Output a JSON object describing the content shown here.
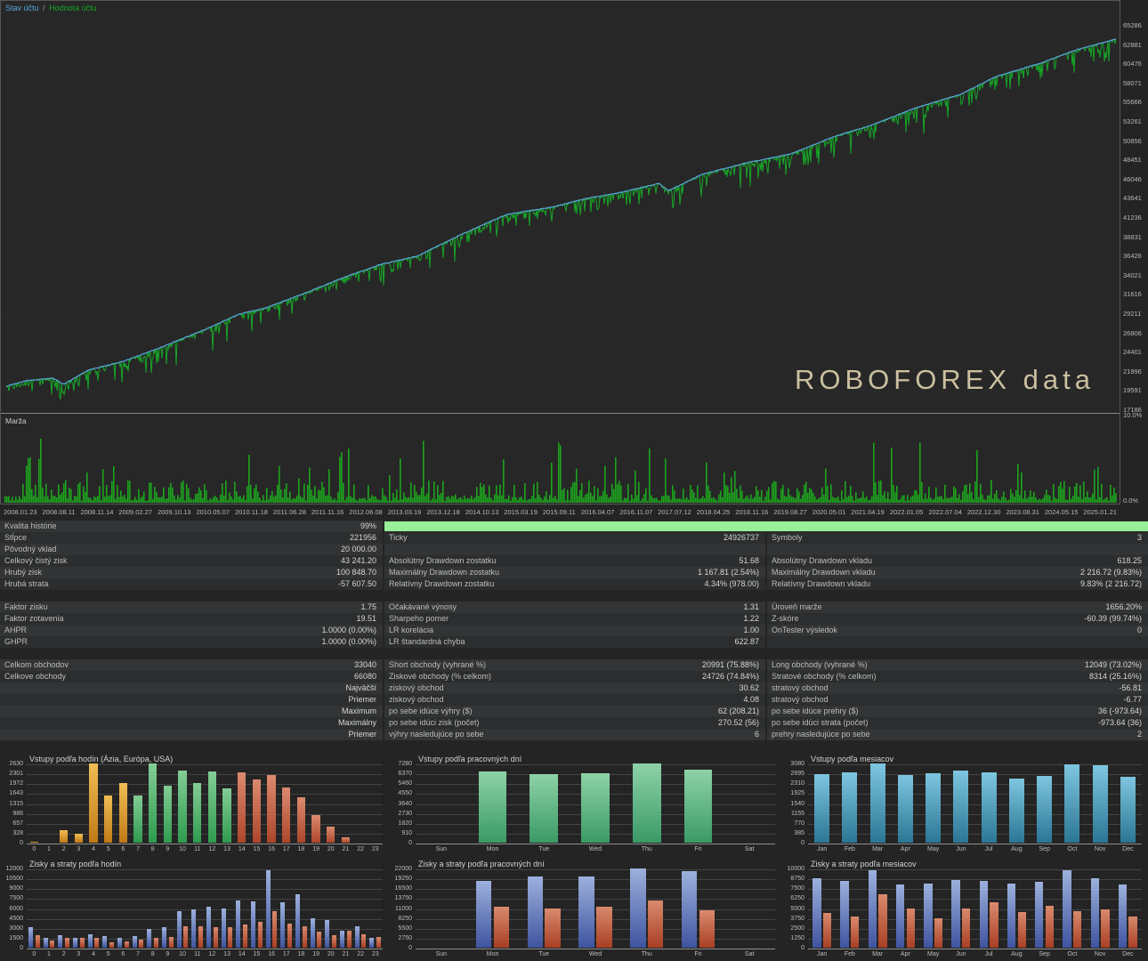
{
  "stats": {
    "rows": [
      {
        "cells": [
          "Kvalita histórie",
          "99%",
          "",
          "",
          "",
          ""
        ],
        "progress": true
      },
      {
        "cells": [
          "Stĺpce",
          "221956",
          "Ticky",
          "24926737",
          "Symboly",
          "3"
        ]
      },
      {
        "cells": [
          "Pôvodný vklad",
          "20 000.00",
          "",
          "",
          "",
          ""
        ]
      },
      {
        "cells": [
          "Celkový čistý zisk",
          "43 241.20",
          "Absolútny Drawdown zostatku",
          "51.68",
          "Absolútny Drawdown vkladu",
          "618.25"
        ]
      },
      {
        "cells": [
          "Hrubý zisk",
          "100 848.70",
          "Maximálny Drawdown zostatku",
          "1 167.81 (2.54%)",
          "Maximálny Drawdown vkladu",
          "2 216.72 (9.83%)"
        ]
      },
      {
        "cells": [
          "Hrubá strata",
          "-57 607.50",
          "Relatívny Drawdown zostatku",
          "4.34% (978.00)",
          "Relatívny Drawdown vkladu",
          "9.83% (2 216.72)"
        ]
      },
      {
        "spacer": true
      },
      {
        "cells": [
          "Faktor zisku",
          "1.75",
          "Očakávané výnosy",
          "1.31",
          "Úroveň marže",
          "1656.20%"
        ]
      },
      {
        "cells": [
          "Faktor zotavenia",
          "19.51",
          "Sharpeho pomer",
          "1.22",
          "Z-skóre",
          "-60.39 (99.74%)"
        ]
      },
      {
        "cells": [
          "AHPR",
          "1.0000 (0.00%)",
          "LR korelácia",
          "1.00",
          "OnTester výsledok",
          "0"
        ]
      },
      {
        "cells": [
          "GHPR",
          "1.0000 (0.00%)",
          "LR štandardná chyba",
          "622.87",
          "",
          ""
        ]
      },
      {
        "spacer": true
      },
      {
        "cells": [
          "Celkom obchodov",
          "33040",
          "Short obchody (vyhrané %)",
          "20991 (75.88%)",
          "Long obchody (vyhrané %)",
          "12049 (73.02%)"
        ]
      },
      {
        "cells": [
          "Celkove obchody",
          "66080",
          "Ziskové obchody (% celkom)",
          "24726 (74.84%)",
          "Stratové obchody (% celkom)",
          "8314 (25.16%)"
        ]
      },
      {
        "cells": [
          "",
          "Najväčší",
          "ziskový obchod",
          "30.62",
          "stratový obchod",
          "-56.81"
        ]
      },
      {
        "cells": [
          "",
          "Priemer",
          "ziskový obchod",
          "4.08",
          "stratový obchod",
          "-6.77"
        ]
      },
      {
        "cells": [
          "",
          "Maximum",
          "po sebe idúce výhry ($)",
          "62 (208.21)",
          "po sebe idúce prehry ($)",
          "36 (-973.64)"
        ]
      },
      {
        "cells": [
          "",
          "Maximálny",
          "po sebe idúci zisk (počet)",
          "270.52 (56)",
          "po sebe idúci strata (počet)",
          "-973.64 (36)"
        ]
      },
      {
        "cells": [
          "",
          "Priemer",
          "výhry nasledujúce po sebe",
          "6",
          "prehry nasledujúce po sebe",
          "2"
        ]
      },
      {
        "spacer": true
      }
    ],
    "progress_color": "#98ef98"
  },
  "chart_data": [
    {
      "type": "line",
      "name": "equity-curve",
      "legend": [
        "Stav účtu",
        "Hodnota účtu"
      ],
      "legend_sep": "/",
      "series": [
        {
          "name": "Stav účtu",
          "color": "#58a6dc"
        },
        {
          "name": "Hodnota účtu",
          "color": "#17a626"
        }
      ],
      "watermark": "ROBOFOREX data",
      "y_ticks": [
        65286,
        62881,
        60476,
        58071,
        55666,
        53261,
        50856,
        48451,
        46046,
        43641,
        41236,
        38831,
        36426,
        34021,
        31616,
        29211,
        26806,
        24401,
        21996,
        19591,
        17186
      ],
      "x_ticks": [
        "2008.01.23",
        "2008.08.11",
        "2008.11.14",
        "2009.02.27",
        "2009.10.13",
        "2010.05.07",
        "2010.11.18",
        "2011.06.28",
        "2011.11.16",
        "2012.06.08",
        "2013.03.19",
        "2013.12.18",
        "2014.10.13",
        "2015.03.19",
        "2015.09.11",
        "2016.04.07",
        "2016.11.07",
        "2017.07.12",
        "2018.04.25",
        "2018.11.16",
        "2019.08.27",
        "2020.05.01",
        "2021.04.19",
        "2022.01.05",
        "2022.07.04",
        "2022.12.30",
        "2023.08.31",
        "2024.05.15",
        "2025.01.21"
      ],
      "anchors": [
        [
          0,
          20190
        ],
        [
          0.018,
          20860
        ],
        [
          0.042,
          21190
        ],
        [
          0.052,
          20450
        ],
        [
          0.074,
          22200
        ],
        [
          0.106,
          23310
        ],
        [
          0.142,
          25200
        ],
        [
          0.178,
          27210
        ],
        [
          0.21,
          29215
        ],
        [
          0.234,
          29990
        ],
        [
          0.266,
          31660
        ],
        [
          0.306,
          33890
        ],
        [
          0.338,
          35450
        ],
        [
          0.37,
          36450
        ],
        [
          0.411,
          39235
        ],
        [
          0.451,
          41684
        ],
        [
          0.491,
          42575
        ],
        [
          0.523,
          43688
        ],
        [
          0.555,
          44468
        ],
        [
          0.588,
          45580
        ],
        [
          0.597,
          44650
        ],
        [
          0.627,
          46693
        ],
        [
          0.667,
          48140
        ],
        [
          0.707,
          49253
        ],
        [
          0.747,
          51480
        ],
        [
          0.779,
          52816
        ],
        [
          0.82,
          55043
        ],
        [
          0.86,
          56713
        ],
        [
          0.892,
          58940
        ],
        [
          0.932,
          60610
        ],
        [
          0.964,
          62280
        ],
        [
          1,
          63616
        ]
      ]
    },
    {
      "type": "bar",
      "name": "margin",
      "title": "Marža",
      "y_ticks": [
        "10.0%",
        "0.0%"
      ],
      "bar_color": "#1da31d"
    },
    {
      "type": "bar",
      "title": "Vstupy podľa hodín (Ázia, Európa, USA)",
      "categories": [
        "0",
        "1",
        "2",
        "3",
        "4",
        "5",
        "6",
        "7",
        "8",
        "9",
        "10",
        "11",
        "12",
        "13",
        "14",
        "15",
        "16",
        "17",
        "18",
        "19",
        "20",
        "21",
        "22",
        "23"
      ],
      "values": [
        30,
        0,
        420,
        310,
        2630,
        1560,
        1980,
        1570,
        2630,
        1900,
        2390,
        1970,
        2360,
        1790,
        2330,
        2100,
        2240,
        1830,
        1500,
        930,
        520,
        190,
        0,
        0
      ],
      "groups": [
        0,
        0,
        0,
        0,
        0,
        0,
        0,
        1,
        1,
        1,
        1,
        1,
        1,
        1,
        2,
        2,
        2,
        2,
        2,
        2,
        2,
        2,
        2,
        2
      ],
      "group_colors": [
        [
          "#f0bd55",
          "#c07a16"
        ],
        [
          "#84cd96",
          "#2e9b4e"
        ],
        [
          "#db8a70",
          "#ad462a"
        ]
      ],
      "ticks": [
        0,
        328,
        657,
        986,
        1315,
        1643,
        1972,
        2301,
        2630
      ]
    },
    {
      "type": "bar",
      "title": "Vstupy podľa pracovných dní",
      "categories": [
        "Sun",
        "Mon",
        "Tue",
        "Wed",
        "Thu",
        "Fri",
        "Sat"
      ],
      "values": [
        0,
        6550,
        6300,
        6350,
        7280,
        6750,
        0
      ],
      "color": [
        "#8ed2a8",
        "#3a9a66"
      ],
      "ticks": [
        0,
        910,
        1820,
        2730,
        3640,
        4550,
        5460,
        6370,
        7280
      ]
    },
    {
      "type": "bar",
      "title": "Vstupy podľa mesiacov",
      "categories": [
        "Jan",
        "Feb",
        "Mar",
        "Apr",
        "May",
        "Jun",
        "Jul",
        "Aug",
        "Sep",
        "Oct",
        "Nov",
        "Dec"
      ],
      "values": [
        2670,
        2750,
        3080,
        2640,
        2700,
        2790,
        2720,
        2510,
        2610,
        3060,
        3020,
        2570
      ],
      "color": [
        "#7ec6e0",
        "#2b7694"
      ],
      "ticks": [
        0,
        385,
        770,
        1155,
        1540,
        1925,
        2310,
        2695,
        3080
      ]
    },
    {
      "type": "bar",
      "title": "Zisky a straty podľa hodín",
      "categories": [
        "0",
        "1",
        "2",
        "3",
        "4",
        "5",
        "6",
        "7",
        "8",
        "9",
        "10",
        "11",
        "12",
        "13",
        "14",
        "15",
        "16",
        "17",
        "18",
        "19",
        "20",
        "21",
        "22",
        "23"
      ],
      "series": [
        {
          "name": "zisky",
          "color": [
            "#9db1dd",
            "#3f54a0"
          ],
          "values": [
            3050,
            1450,
            1900,
            1500,
            2000,
            1750,
            1500,
            1700,
            2850,
            3100,
            5600,
            5800,
            6200,
            6000,
            7100,
            7050,
            11800,
            6900,
            8100,
            4400,
            4200,
            2600,
            3200,
            1550
          ]
        },
        {
          "name": "straty",
          "color": [
            "#d98a6e",
            "#a93f24"
          ],
          "values": [
            1900,
            1150,
            1500,
            1500,
            1550,
            850,
            900,
            1200,
            1500,
            1650,
            3300,
            3250,
            3050,
            3100,
            3500,
            3950,
            5600,
            3700,
            3300,
            2500,
            1900,
            2550,
            2050,
            1600
          ]
        }
      ],
      "ticks": [
        0,
        1500,
        3000,
        4500,
        6000,
        7500,
        9000,
        10500,
        12000
      ]
    },
    {
      "type": "bar",
      "title": "Zisky a straty podľa pracovných dní",
      "categories": [
        "Sun",
        "Mon",
        "Tue",
        "Wed",
        "Thu",
        "Fri",
        "Sat"
      ],
      "series": [
        {
          "name": "zisky",
          "color": [
            "#9db1dd",
            "#3f54a0"
          ],
          "values": [
            0,
            18500,
            19800,
            19900,
            22000,
            21200,
            0
          ]
        },
        {
          "name": "straty",
          "color": [
            "#d98a6e",
            "#a93f24"
          ],
          "values": [
            0,
            11300,
            10800,
            11300,
            13100,
            10300,
            0
          ]
        }
      ],
      "ticks": [
        0,
        2750,
        5500,
        8250,
        11000,
        13750,
        16500,
        19250,
        22000
      ]
    },
    {
      "type": "bar",
      "title": "Zisky a straty podľa mesiacov",
      "categories": [
        "Jan",
        "Feb",
        "Mar",
        "Apr",
        "May",
        "Jun",
        "Jul",
        "Aug",
        "Sep",
        "Oct",
        "Nov",
        "Dec"
      ],
      "series": [
        {
          "name": "zisky",
          "color": [
            "#9db1dd",
            "#3f54a0"
          ],
          "values": [
            8750,
            8400,
            9800,
            7950,
            8150,
            8500,
            8400,
            8100,
            8300,
            9750,
            8750,
            7950
          ]
        },
        {
          "name": "straty",
          "color": [
            "#d98a6e",
            "#a93f24"
          ],
          "values": [
            4350,
            3950,
            6700,
            5000,
            3750,
            4900,
            5750,
            4500,
            5250,
            4650,
            4800,
            3900
          ]
        }
      ],
      "ticks": [
        0,
        1250,
        2500,
        3750,
        5000,
        6250,
        7500,
        8750,
        10000
      ]
    }
  ]
}
